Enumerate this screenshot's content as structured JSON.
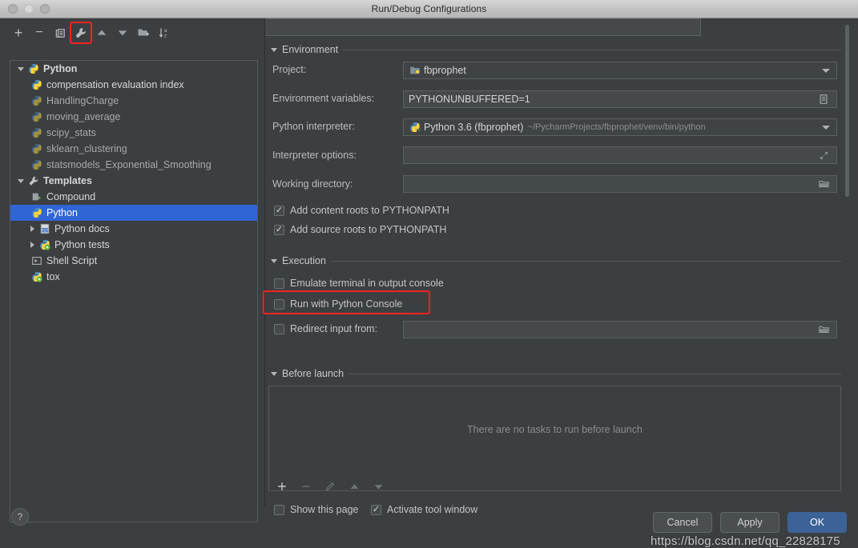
{
  "window": {
    "title": "Run/Debug Configurations"
  },
  "toolbar": {
    "buttons": [
      {
        "name": "add",
        "label": "+",
        "icon": "plus-icon"
      },
      {
        "name": "remove",
        "label": "−",
        "icon": "minus-icon"
      },
      {
        "name": "copy",
        "label": "",
        "icon": "copy-icon"
      },
      {
        "name": "edit-templates",
        "label": "",
        "icon": "wrench-icon",
        "highlighted": true
      },
      {
        "name": "move-up",
        "label": "",
        "icon": "arrow-up-icon"
      },
      {
        "name": "move-down",
        "label": "",
        "icon": "arrow-down-icon"
      },
      {
        "name": "move-into-folder",
        "label": "",
        "icon": "folder-add-icon"
      },
      {
        "name": "sort-alphabetically",
        "label": "",
        "icon": "sort-az-icon"
      }
    ]
  },
  "tree": {
    "items": [
      {
        "label": "Python",
        "icon": "python-icon",
        "indent": 0,
        "twisty": "open",
        "style": "bold",
        "selected": false
      },
      {
        "label": "compensation evaluation index",
        "icon": "python-icon",
        "indent": 2,
        "twisty": "none",
        "style": "bright",
        "selected": false
      },
      {
        "label": "HandlingCharge",
        "icon": "python-dim-icon",
        "indent": 2,
        "twisty": "none",
        "style": "normal",
        "selected": false
      },
      {
        "label": "moving_average",
        "icon": "python-dim-icon",
        "indent": 2,
        "twisty": "none",
        "style": "normal",
        "selected": false
      },
      {
        "label": "scipy_stats",
        "icon": "python-dim-icon",
        "indent": 2,
        "twisty": "none",
        "style": "normal",
        "selected": false
      },
      {
        "label": "sklearn_clustering",
        "icon": "python-dim-icon",
        "indent": 2,
        "twisty": "none",
        "style": "normal",
        "selected": false
      },
      {
        "label": "statsmodels_Exponential_Smoothing",
        "icon": "python-dim-icon",
        "indent": 2,
        "twisty": "none",
        "style": "normal",
        "selected": false
      },
      {
        "label": "Templates",
        "icon": "wrench-icon",
        "indent": 0,
        "twisty": "open",
        "style": "bold",
        "selected": false
      },
      {
        "label": "Compound",
        "icon": "compound-icon",
        "indent": 2,
        "twisty": "none",
        "style": "bright",
        "selected": false
      },
      {
        "label": "Python",
        "icon": "python-icon",
        "indent": 2,
        "twisty": "none",
        "style": "bright",
        "selected": true
      },
      {
        "label": "Python docs",
        "icon": "rst-icon",
        "indent": 1,
        "twisty": "closed",
        "style": "bright",
        "selected": false
      },
      {
        "label": "Python tests",
        "icon": "pytest-icon",
        "indent": 1,
        "twisty": "closed",
        "style": "bright",
        "selected": false
      },
      {
        "label": "Shell Script",
        "icon": "shell-icon",
        "indent": 2,
        "twisty": "none",
        "style": "bright",
        "selected": false
      },
      {
        "label": "tox",
        "icon": "pytest-icon",
        "indent": 2,
        "twisty": "none",
        "style": "bright",
        "selected": false
      }
    ]
  },
  "help": {
    "label": "?"
  },
  "form": {
    "environment_section": {
      "label": "Environment"
    },
    "execution_section": {
      "label": "Execution"
    },
    "before_launch_section": {
      "label": "Before launch"
    },
    "project": {
      "label": "Project:",
      "value": "fbprophet",
      "icon": "project-icon"
    },
    "env_vars": {
      "label": "Environment variables:",
      "value": "PYTHONUNBUFFERED=1",
      "button_icon": "env-list-icon"
    },
    "interpreter": {
      "label": "Python interpreter:",
      "value": "Python 3.6 (fbprophet)",
      "path": "~/PycharmProjects/fbprophet/venv/bin/python",
      "icon": "python-venv-icon"
    },
    "interpreter_options": {
      "label": "Interpreter options:",
      "value": "",
      "button_icon": "expand-icon"
    },
    "working_directory": {
      "label": "Working directory:",
      "value": "",
      "button_icon": "folder-icon"
    },
    "add_content_roots": {
      "label": "Add content roots to PYTHONPATH",
      "checked": true
    },
    "add_source_roots": {
      "label": "Add source roots to PYTHONPATH",
      "checked": true
    },
    "emulate_terminal": {
      "label": "Emulate terminal in output console",
      "checked": false
    },
    "run_with_console": {
      "label": "Run with Python Console",
      "checked": false,
      "highlighted": true
    },
    "redirect_input": {
      "label": "Redirect input from:",
      "checked": false,
      "value": "",
      "button_icon": "folder-icon"
    },
    "before_launch_empty": "There are no tasks to run before launch",
    "before_launch_toolbar": [
      {
        "name": "add-task",
        "icon": "plus-icon"
      },
      {
        "name": "remove-task",
        "icon": "minus-icon"
      },
      {
        "name": "edit-task",
        "icon": "pencil-icon"
      },
      {
        "name": "move-task-up",
        "icon": "arrow-up-icon"
      },
      {
        "name": "move-task-down",
        "icon": "arrow-down-icon"
      }
    ],
    "show_this_page": {
      "label": "Show this page",
      "checked": false
    },
    "activate_tool_window": {
      "label": "Activate tool window",
      "checked": true
    }
  },
  "buttons": {
    "cancel": "Cancel",
    "apply": "Apply",
    "ok": "OK"
  },
  "watermark": {
    "text": "https://blog.csdn.net/qq_22828175"
  },
  "colors": {
    "selection_blue": "#2f65d4",
    "highlight_red": "#f2231f",
    "primary_button": "#3c6397",
    "panel_bg": "#3c3f41",
    "field_bg": "#45494a"
  },
  "checkmark": "✓"
}
